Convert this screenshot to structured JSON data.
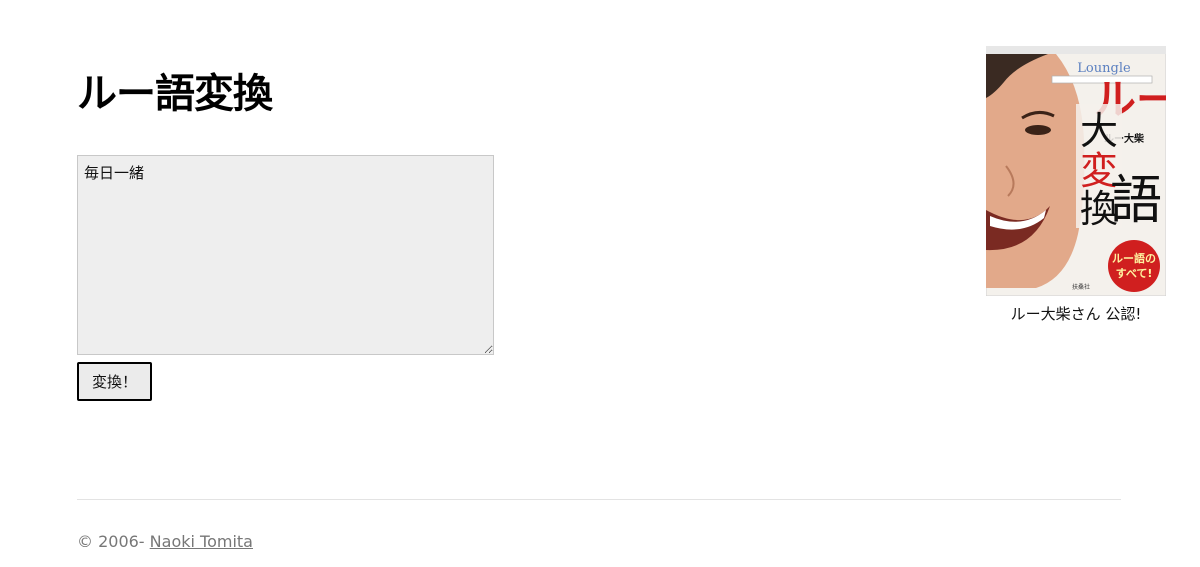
{
  "header": {
    "title": "ルー語変換"
  },
  "form": {
    "input_value": "毎日一緒",
    "submit_label": "変換！"
  },
  "sidebar": {
    "book": {
      "cover_heading": "ルー語",
      "cover_subheading": "大変換",
      "cover_author": "ルー大柴",
      "cover_logo": "Loungle",
      "cover_badge": "ルー語のすべて！",
      "cover_publisher": "扶桑社"
    },
    "caption": "ルー大柴さん 公認!"
  },
  "footer": {
    "copyright": "© 2006- ",
    "author_link": "Naoki Tomita"
  },
  "colors": {
    "background": "#ffffff",
    "input_background": "#eeeeee",
    "cover_red": "#d01f1f",
    "footer_text": "#777777"
  }
}
